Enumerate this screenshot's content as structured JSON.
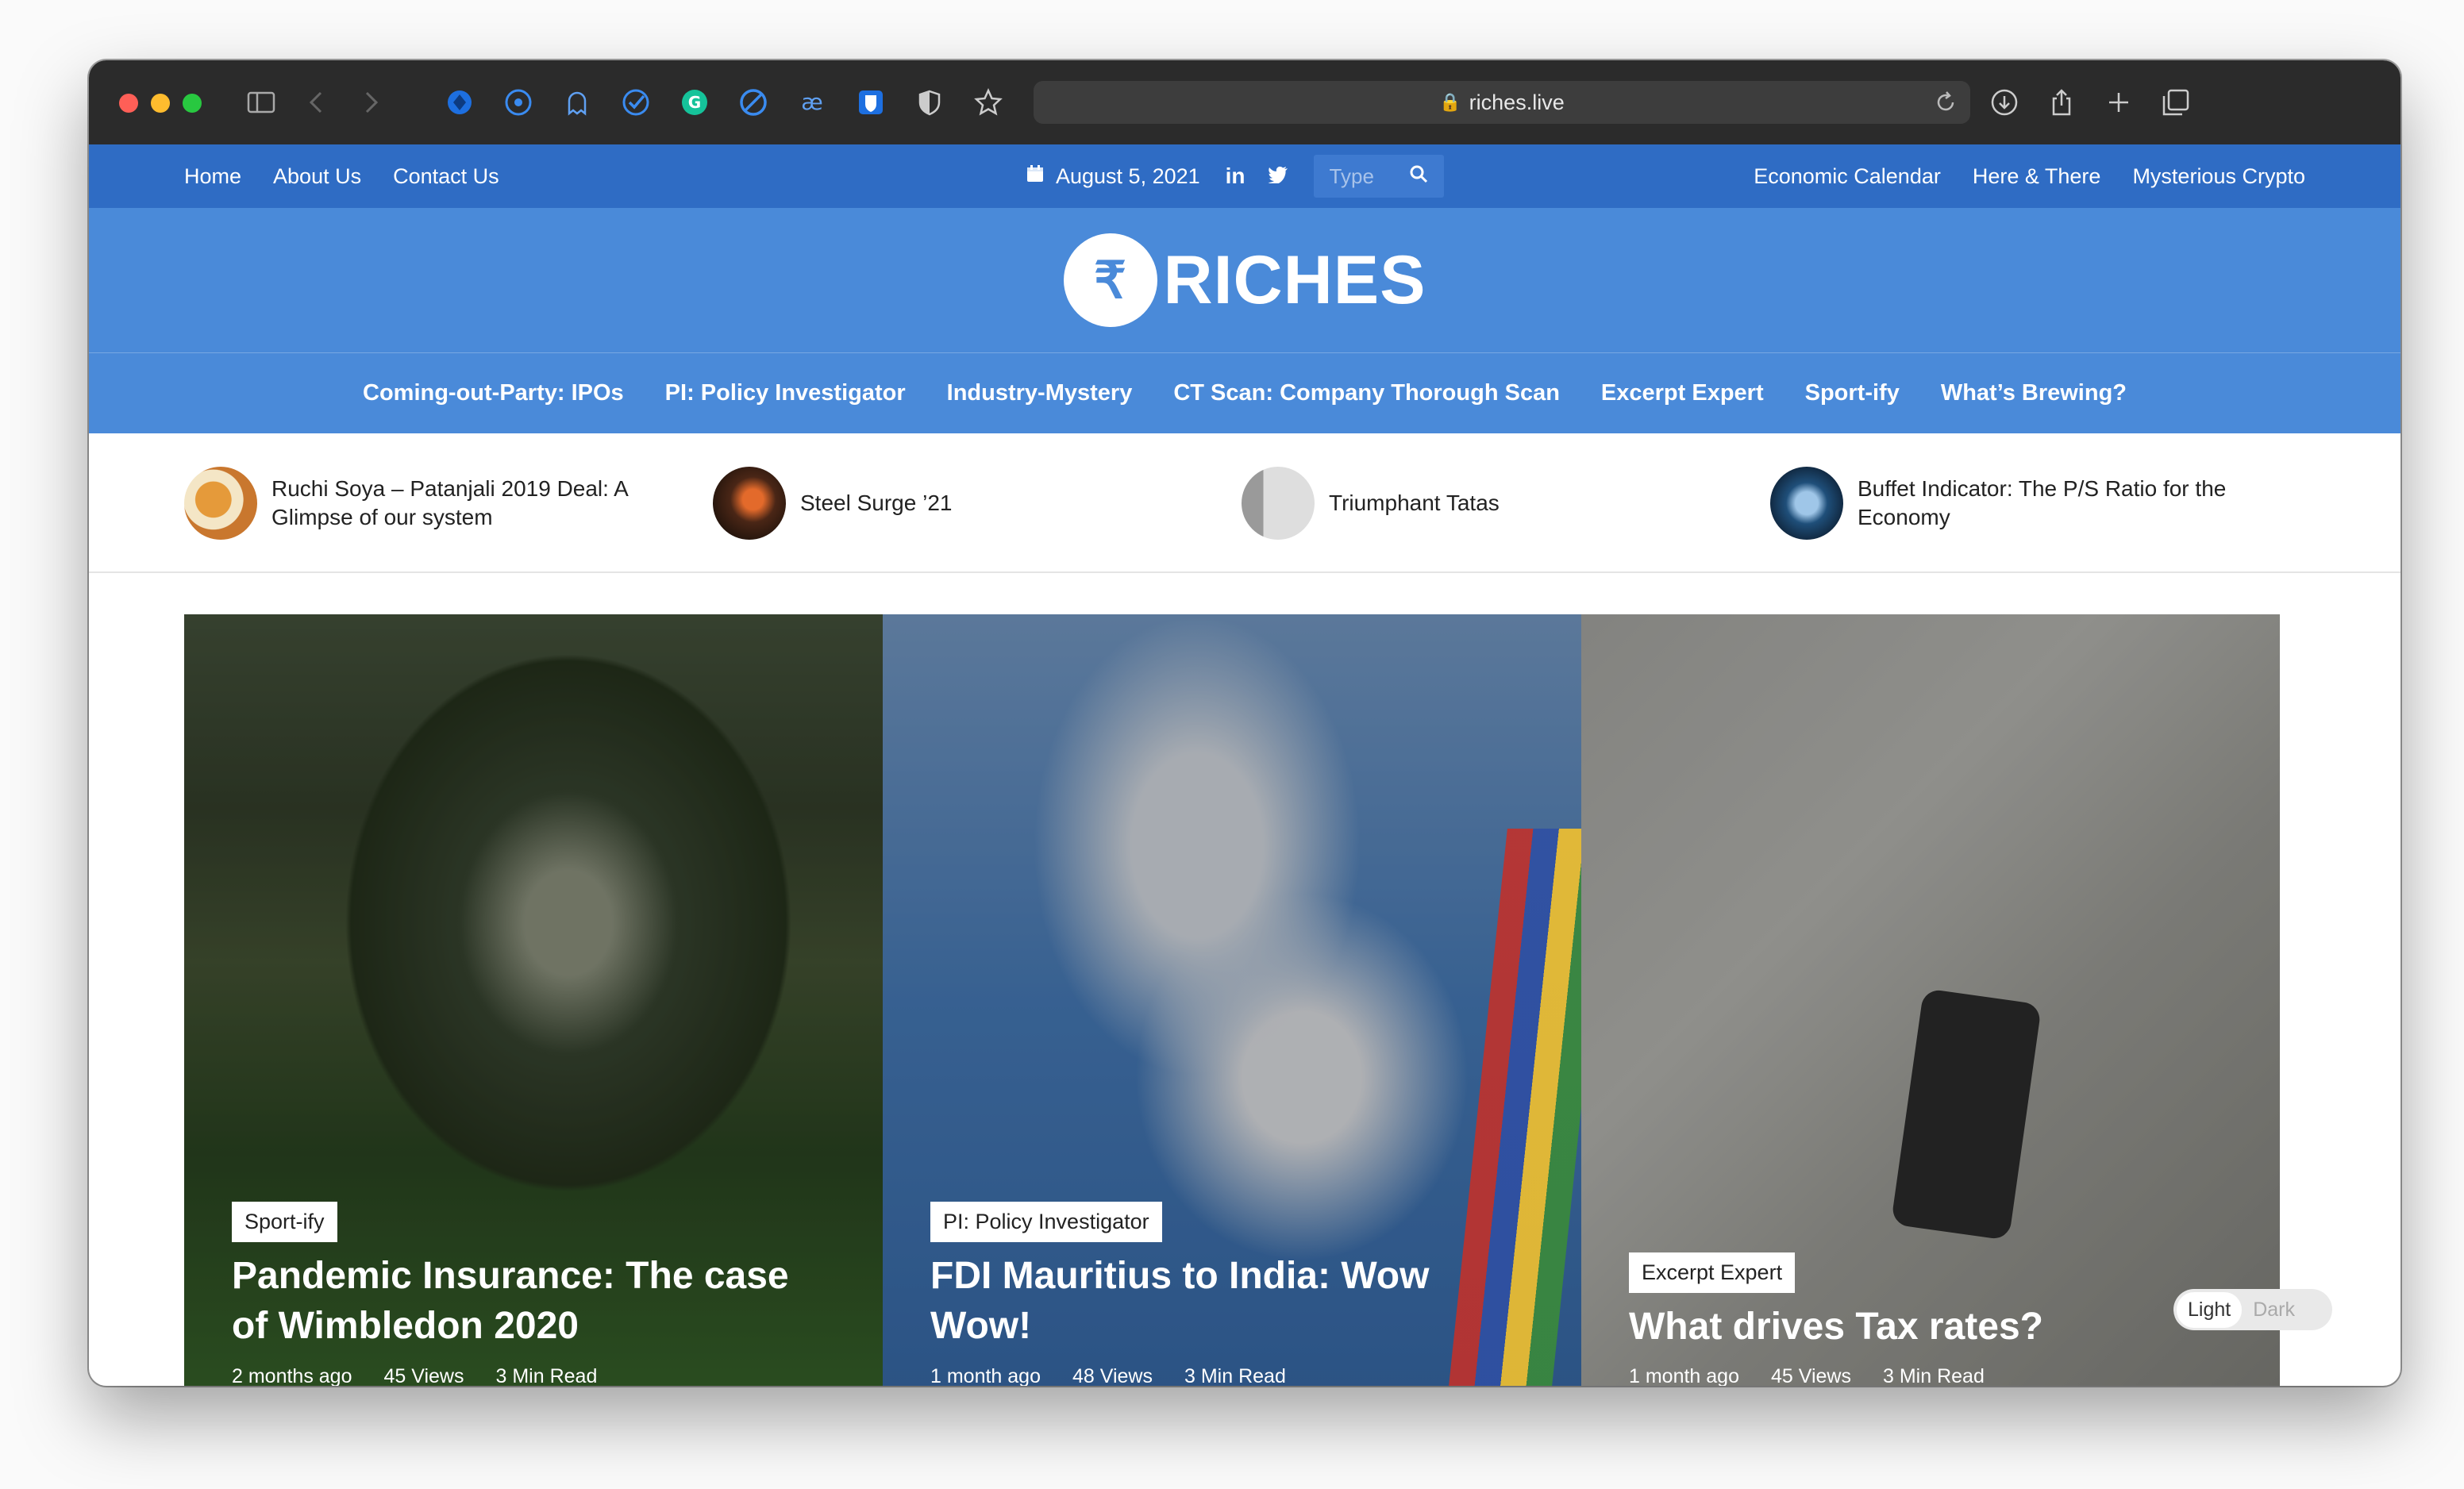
{
  "browser": {
    "url": "riches.live"
  },
  "topbar": {
    "left_links": [
      "Home",
      "About Us",
      "Contact Us"
    ],
    "date": "August 5, 2021",
    "search_placeholder": "Type",
    "right_links": [
      "Economic Calendar",
      "Here & There",
      "Mysterious Crypto"
    ]
  },
  "logo": {
    "symbol": "₹",
    "text": "RICHES"
  },
  "main_nav": [
    "Coming-out-Party: IPOs",
    "PI: Policy Investigator",
    "Industry-Mystery",
    "CT Scan: Company Thorough Scan",
    "Excerpt Expert",
    "Sport-ify",
    "What’s Brewing?"
  ],
  "ticker": [
    {
      "title": "Ruchi Soya – Patanjali 2019 Deal: A Glimpse of our system",
      "thumb_color": "#c9772e"
    },
    {
      "title": "Steel Surge ’21",
      "thumb_color": "#6b3a22"
    },
    {
      "title": "Triumphant Tatas",
      "thumb_color": "#b9b9b9"
    },
    {
      "title": "Buffet Indicator: The P/S Ratio for the Economy",
      "thumb_color": "#1f4f7a"
    }
  ],
  "cards": [
    {
      "category": "Sport-ify",
      "title": "Pandemic Insurance: The case of Wimbledon 2020",
      "time": "2 months ago",
      "views": "45 Views",
      "read": "3 Min Read"
    },
    {
      "category": "PI: Policy Investigator",
      "title": "FDI Mauritius to India: Wow Wow!",
      "time": "1 month ago",
      "views": "48 Views",
      "read": "3 Min Read"
    },
    {
      "category": "Excerpt Expert",
      "title": "What drives Tax rates?",
      "time": "1 month ago",
      "views": "45 Views",
      "read": "3 Min Read"
    }
  ],
  "theme_toggle": {
    "light": "Light",
    "dark": "Dark"
  },
  "colors": {
    "topbar": "#2f6cc4",
    "header": "#4a8ad9",
    "toolbar": "#2b2b2b"
  }
}
